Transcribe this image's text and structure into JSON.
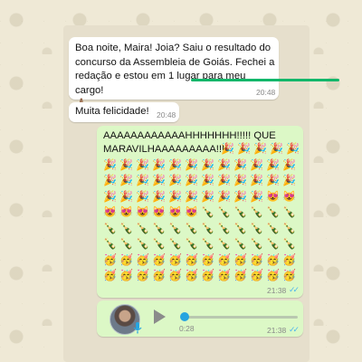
{
  "messages": [
    {
      "text_lines": [
        "Boa noite, Maira! Joia? Saiu o resultado do",
        "concurso da Assembleia de Goiás. Fechei a",
        "redação e estou em 1 lugar para meu cargo!",
        "🙏🏽"
      ],
      "time": "20:48"
    },
    {
      "text": "Muita felicidade!",
      "time": "20:48"
    },
    {
      "text_lines": [
        "AAAAAAAAAAAAHHHHHHH!!!!! QUE",
        "MARAVILHAAAAAAAAA!!!"
      ],
      "time": "21:38",
      "status": "read"
    },
    {
      "type": "audio",
      "duration": "0:28",
      "time": "21:38",
      "status": "read",
      "progress": 0
    }
  ],
  "emoji_rows": [
    "🎉🎉🎉🎉🎉",
    "🎉🎉🎉🎉🎉🎉🎉🎉🎉🎉🎉🎉",
    "🎉🎉🎉🎉🎉🎉🎉🎉🎉🎉🎉🎉",
    "🎉🎉🎉🎉🎉🎉🎉🎉🎉🎉😻😻",
    "😻😻😻😻😻😻🍾🍾🍾🍾🍾🍾",
    "🍾🍾🍾🍾🍾🍾🍾🍾🍾🍾🍾🍾",
    "🍾🍾🍾🍾🍾🍾🍾🍾🍾🍾🍾🍾",
    "🥳🥳🥳🥳🥳🥳🥳🥳🥳🥳🥳🥳",
    "🥳🥳🥳🥳🥳🥳🥳🥳🥳🥳🥳🥳"
  ],
  "colors": {
    "incoming": "#ffffff",
    "outgoing": "#dcf8c6",
    "highlight_underline": "#12b76a",
    "read_ticks": "#4fb6ec",
    "audio_progress": "#26a4e0"
  },
  "icons": [
    "pray-emoji-icon",
    "double-check-icon",
    "play-icon",
    "mic-icon",
    "avatar"
  ]
}
